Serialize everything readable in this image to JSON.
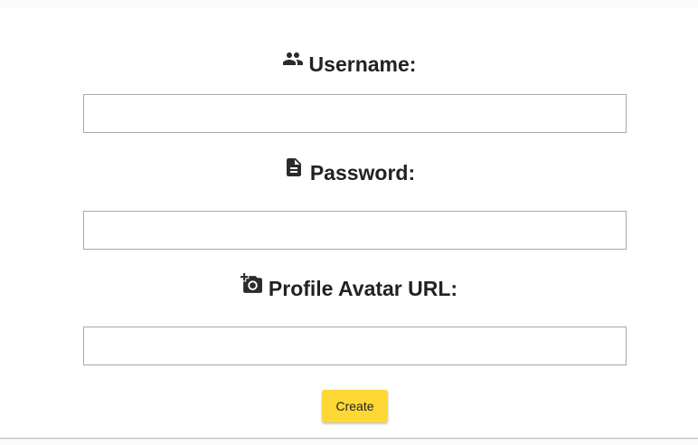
{
  "form": {
    "username": {
      "label": "Username:",
      "icon": "people-icon",
      "value": "",
      "placeholder": ""
    },
    "password": {
      "label": "Password:",
      "icon": "document-icon",
      "value": "",
      "placeholder": ""
    },
    "avatar_url": {
      "label": "Profile Avatar URL:",
      "icon": "add-photo-icon",
      "value": "",
      "placeholder": ""
    },
    "submit_label": "Create"
  },
  "colors": {
    "page_background": "#fafafa",
    "card_background": "#ffffff",
    "label_text": "#222222",
    "input_border": "#a9a9a9",
    "button_background": "#fdd835"
  }
}
